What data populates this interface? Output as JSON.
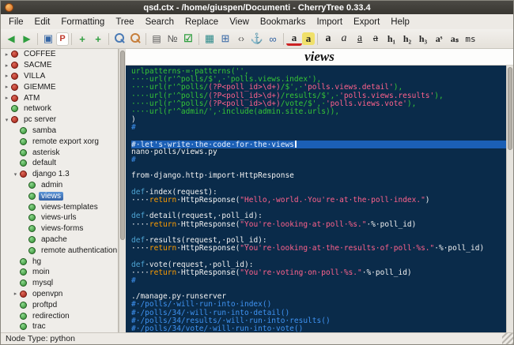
{
  "window": {
    "title": "qsd.ctx - /home/giuspen/Documenti - CherryTree 0.33.4"
  },
  "menubar": [
    "File",
    "Edit",
    "Formatting",
    "Tree",
    "Search",
    "Replace",
    "View",
    "Bookmarks",
    "Import",
    "Export",
    "Help"
  ],
  "toolbar": [
    {
      "name": "go-back-icon",
      "glyph": "◀",
      "cls": "arrow"
    },
    {
      "name": "go-forward-icon",
      "glyph": "▶",
      "cls": "arrow"
    },
    {
      "name": "separator"
    },
    {
      "name": "save-icon",
      "glyph": "▣",
      "cls": "blue"
    },
    {
      "name": "export-pdf-icon",
      "glyph": "P",
      "cls": "red"
    },
    {
      "name": "separator"
    },
    {
      "name": "add-node-icon",
      "glyph": "+",
      "cls": "green2"
    },
    {
      "name": "add-subnode-icon",
      "glyph": "+",
      "cls": "green2"
    },
    {
      "name": "separator"
    },
    {
      "name": "search-icon",
      "glyph": "",
      "cls": "mag"
    },
    {
      "name": "find-replace-icon",
      "glyph": "",
      "cls": "mag orange"
    },
    {
      "name": "separator"
    },
    {
      "name": "bullet-list-icon",
      "glyph": "▤",
      "cls": "dark"
    },
    {
      "name": "numbered-list-icon",
      "glyph": "№",
      "cls": "dark"
    },
    {
      "name": "todo-list-icon",
      "glyph": "☑",
      "cls": "green2"
    },
    {
      "name": "separator"
    },
    {
      "name": "insert-image-icon",
      "glyph": "▦",
      "cls": "teal"
    },
    {
      "name": "insert-table-icon",
      "glyph": "⊞",
      "cls": "blue"
    },
    {
      "name": "insert-codebox-icon",
      "glyph": "‹›",
      "cls": "dark"
    },
    {
      "name": "insert-anchor-icon",
      "glyph": "⚓",
      "cls": "blue"
    },
    {
      "name": "insert-link-icon",
      "glyph": "∞",
      "cls": "blue"
    },
    {
      "name": "separator"
    },
    {
      "name": "text-color-icon",
      "glyph": "a",
      "cls": "fg"
    },
    {
      "name": "background-color-icon",
      "glyph": "a",
      "cls": "bgc"
    },
    {
      "name": "separator"
    },
    {
      "name": "bold-icon",
      "glyph": "a",
      "cls": "b"
    },
    {
      "name": "italic-icon",
      "glyph": "a",
      "cls": "i"
    },
    {
      "name": "underline-icon",
      "glyph": "a",
      "cls": "u"
    },
    {
      "name": "strikethrough-icon",
      "glyph": "a",
      "cls": "s"
    },
    {
      "name": "h1-icon",
      "glyph": "h₁",
      "cls": "h"
    },
    {
      "name": "h2-icon",
      "glyph": "h₂",
      "cls": "h"
    },
    {
      "name": "h3-icon",
      "glyph": "h₃",
      "cls": "h"
    },
    {
      "name": "superscript-icon",
      "glyph": "aˢ",
      "cls": "h"
    },
    {
      "name": "subscript-icon",
      "glyph": "aₛ",
      "cls": "h"
    },
    {
      "name": "monospace-icon",
      "glyph": "ms",
      "cls": "mono"
    }
  ],
  "sidebar": {
    "items": [
      {
        "label": "COFFEE",
        "level": 0,
        "icon": "red",
        "exp": "c"
      },
      {
        "label": "SACME",
        "level": 0,
        "icon": "red",
        "exp": "c"
      },
      {
        "label": "VILLA",
        "level": 0,
        "icon": "red",
        "exp": "c"
      },
      {
        "label": "GIEMME",
        "level": 0,
        "icon": "red",
        "exp": "c"
      },
      {
        "label": "ATM",
        "level": 0,
        "icon": "red",
        "exp": "c"
      },
      {
        "label": "network",
        "level": 0,
        "icon": "green"
      },
      {
        "label": "pc server",
        "level": 0,
        "icon": "red",
        "exp": "e"
      },
      {
        "label": "samba",
        "level": 1,
        "icon": "green"
      },
      {
        "label": "remote export xorg",
        "level": 1,
        "icon": "green"
      },
      {
        "label": "asterisk",
        "level": 1,
        "icon": "green"
      },
      {
        "label": "default",
        "level": 1,
        "icon": "green"
      },
      {
        "label": "django 1.3",
        "level": 1,
        "icon": "red",
        "exp": "e"
      },
      {
        "label": "admin",
        "level": 2,
        "icon": "green"
      },
      {
        "label": "views",
        "level": 2,
        "icon": "green",
        "selected": true
      },
      {
        "label": "views-templates",
        "level": 2,
        "icon": "green"
      },
      {
        "label": "views-urls",
        "level": 2,
        "icon": "green"
      },
      {
        "label": "views-forms",
        "level": 2,
        "icon": "green"
      },
      {
        "label": "apache",
        "level": 2,
        "icon": "green"
      },
      {
        "label": "remote authentication",
        "level": 2,
        "icon": "green"
      },
      {
        "label": "hg",
        "level": 1,
        "icon": "green"
      },
      {
        "label": "moin",
        "level": 1,
        "icon": "green"
      },
      {
        "label": "mysql",
        "level": 1,
        "icon": "green"
      },
      {
        "label": "openvpn",
        "level": 1,
        "icon": "red",
        "exp": "c"
      },
      {
        "label": "proftpd",
        "level": 1,
        "icon": "green"
      },
      {
        "label": "redirection",
        "level": 1,
        "icon": "green"
      },
      {
        "label": "trac",
        "level": 1,
        "icon": "green"
      }
    ]
  },
  "editor": {
    "node_title": "views",
    "colors": {
      "editor_bg": "#0a2b4a",
      "selected_line_bg": "#1b5fb5",
      "tree_selection_bg": "#3563a5",
      "code_green": "#36c536",
      "code_pink": "#ff628c",
      "code_comment_blue": "#3f93f2",
      "code_def_cyan": "#4fa6d5",
      "code_return_orange": "#ff9d00",
      "code_text": "#f2f2f2"
    },
    "lines": [
      {
        "seg": [
          [
            "g",
            "urlpatterns·=·patterns('',"
          ]
        ]
      },
      {
        "seg": [
          [
            "g",
            "····url(r'^polls/$',·'polls.views.index'),"
          ]
        ]
      },
      {
        "seg": [
          [
            "g",
            "····url(r'^polls/"
          ],
          [
            "p",
            "(?P<poll_id>\\d+)"
          ],
          [
            "g",
            "/$',·"
          ],
          [
            "p",
            "'polls.views.detail'"
          ],
          [
            "g",
            "),"
          ]
        ]
      },
      {
        "seg": [
          [
            "g",
            "····url(r'^polls/"
          ],
          [
            "p",
            "(?P<poll_id>\\d+)"
          ],
          [
            "g",
            "/results/$',·"
          ],
          [
            "p",
            "'polls.views.results'"
          ],
          [
            "g",
            "),"
          ]
        ]
      },
      {
        "seg": [
          [
            "g",
            "····url(r'^polls/"
          ],
          [
            "p",
            "(?P<poll_id>\\d+)"
          ],
          [
            "g",
            "/vote/$',·"
          ],
          [
            "p",
            "'polls.views.vote'"
          ],
          [
            "g",
            "),"
          ]
        ]
      },
      {
        "seg": [
          [
            "g",
            "····url(r'^admin/',·include(admin.site.urls)),"
          ]
        ]
      },
      {
        "seg": [
          [
            "w",
            ")"
          ]
        ]
      },
      {
        "seg": [
          [
            "c",
            "#"
          ]
        ]
      },
      {
        "seg": []
      },
      {
        "sel": true,
        "cursor": true,
        "seg": [
          [
            "selt",
            "#·let's·write·the·code·for·the·views"
          ]
        ]
      },
      {
        "seg": [
          [
            "w",
            "nano·polls/views.py"
          ]
        ]
      },
      {
        "seg": [
          [
            "c",
            "#"
          ]
        ]
      },
      {
        "seg": []
      },
      {
        "seg": [
          [
            "w",
            "from·django.http·import·HttpResponse"
          ]
        ]
      },
      {
        "seg": []
      },
      {
        "seg": [
          [
            "d",
            "def"
          ],
          [
            "w",
            "·index(request):"
          ]
        ]
      },
      {
        "seg": [
          [
            "w",
            "····"
          ],
          [
            "k",
            "return"
          ],
          [
            "w",
            "·HttpResponse("
          ],
          [
            "p",
            "\"Hello,·world.·You're·at·the·poll·index.\""
          ],
          [
            "w",
            ")"
          ]
        ]
      },
      {
        "seg": []
      },
      {
        "seg": [
          [
            "d",
            "def"
          ],
          [
            "w",
            "·detail(request,·poll_id):"
          ]
        ]
      },
      {
        "seg": [
          [
            "w",
            "····"
          ],
          [
            "k",
            "return"
          ],
          [
            "w",
            "·HttpResponse("
          ],
          [
            "p",
            "\"You're·looking·at·poll·%s.\""
          ],
          [
            "w",
            "·%·poll_id)"
          ]
        ]
      },
      {
        "seg": []
      },
      {
        "seg": [
          [
            "d",
            "def"
          ],
          [
            "w",
            "·results(request,·poll_id):"
          ]
        ]
      },
      {
        "seg": [
          [
            "w",
            "····"
          ],
          [
            "k",
            "return"
          ],
          [
            "w",
            "·HttpResponse("
          ],
          [
            "p",
            "\"You're·looking·at·the·results·of·poll·%s.\""
          ],
          [
            "w",
            "·%·poll_id)"
          ]
        ]
      },
      {
        "seg": []
      },
      {
        "seg": [
          [
            "d",
            "def"
          ],
          [
            "w",
            "·vote(request,·poll_id):"
          ]
        ]
      },
      {
        "seg": [
          [
            "w",
            "····"
          ],
          [
            "k",
            "return"
          ],
          [
            "w",
            "·HttpResponse("
          ],
          [
            "p",
            "\"You're·voting·on·poll·%s.\""
          ],
          [
            "w",
            "·%·poll_id)"
          ]
        ]
      },
      {
        "seg": [
          [
            "c",
            "#"
          ]
        ]
      },
      {
        "seg": []
      },
      {
        "seg": [
          [
            "w",
            "./manage.py·runserver"
          ]
        ]
      },
      {
        "seg": [
          [
            "c",
            "#·/polls/·will·run·into·index()"
          ]
        ]
      },
      {
        "seg": [
          [
            "c",
            "#·/polls/34/·will·run·into·detail()"
          ]
        ]
      },
      {
        "seg": [
          [
            "c",
            "#·/polls/34/results/·will·run·into·results()"
          ]
        ]
      },
      {
        "seg": [
          [
            "c",
            "#·/polls/34/vote/·will·run·into·vote()"
          ]
        ]
      }
    ]
  },
  "statusbar": {
    "text": "Node Type: python"
  }
}
